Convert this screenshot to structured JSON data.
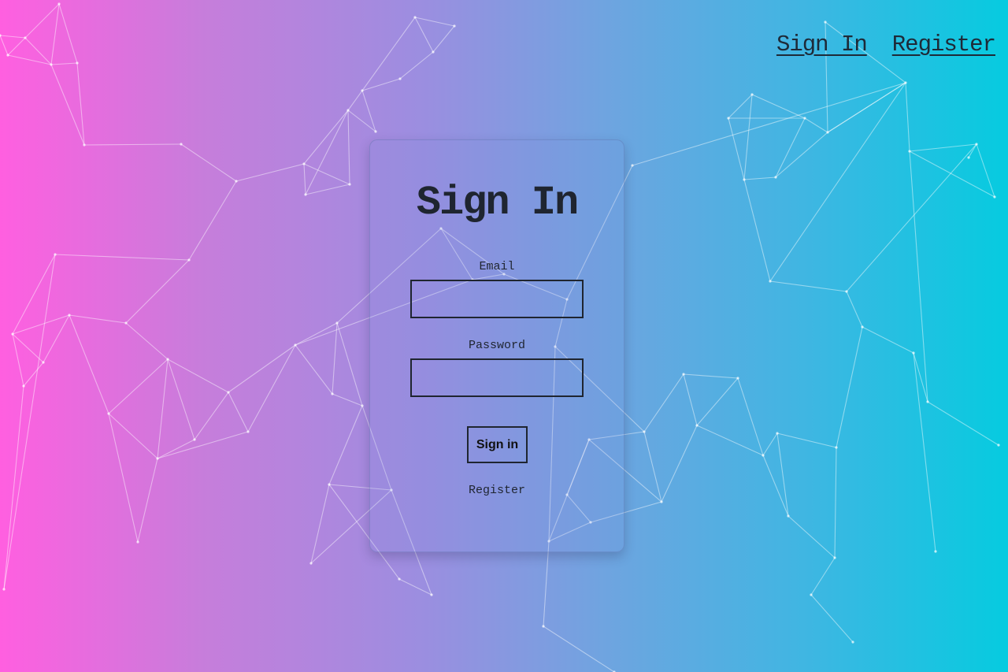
{
  "nav": {
    "sign_in_label": "Sign In",
    "register_label": "Register"
  },
  "form": {
    "title": "Sign In",
    "email_label": "Email",
    "email_value": "",
    "password_label": "Password",
    "password_value": "",
    "submit_label": "Sign in",
    "register_link_label": "Register"
  },
  "theme": {
    "gradient_start": "#ff5fe0",
    "gradient_end": "#06cbe0",
    "text_color": "#1f2530",
    "network_line_color": "#ffffff"
  }
}
